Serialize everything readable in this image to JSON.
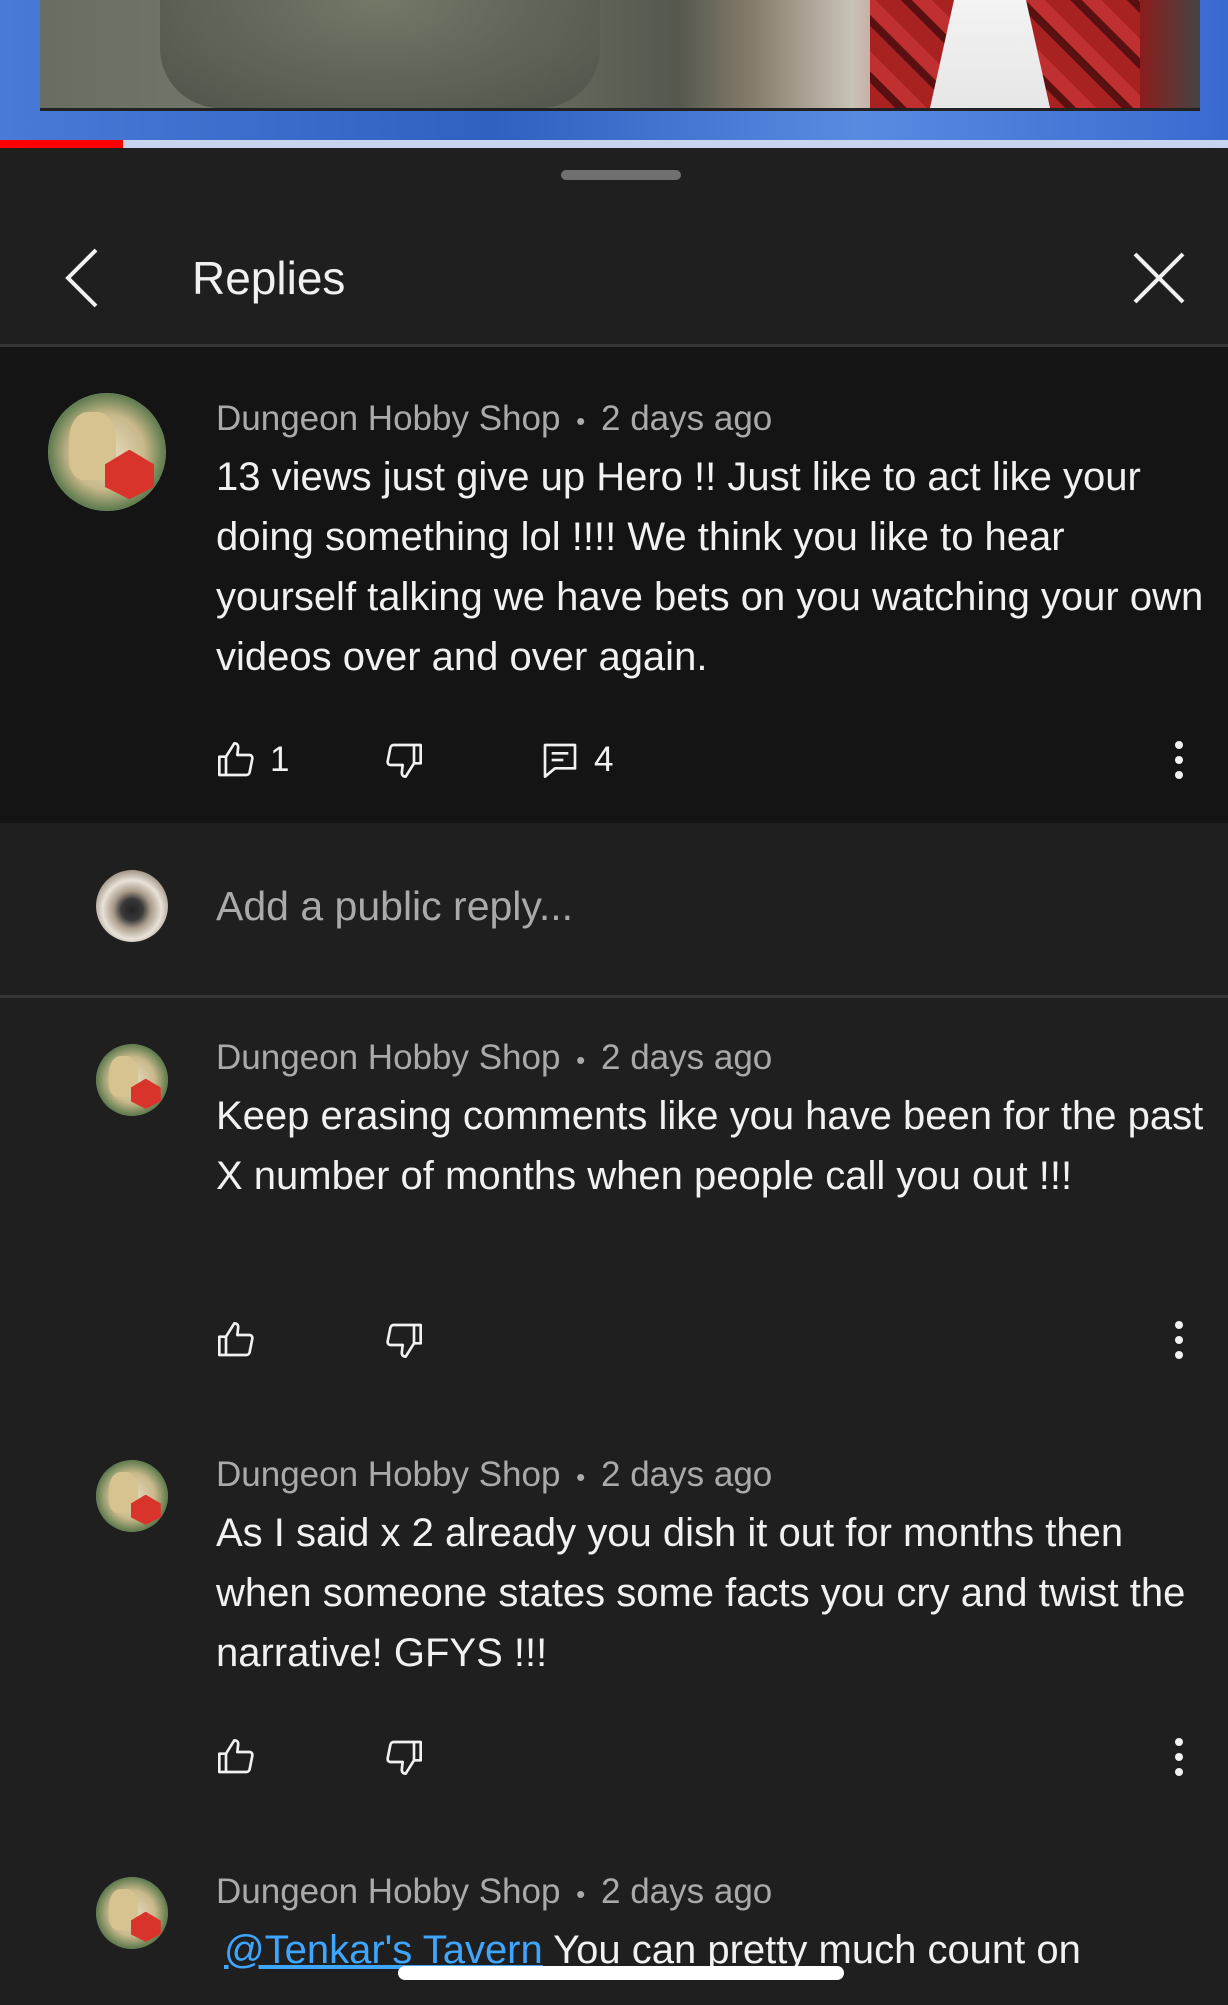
{
  "video": {
    "progress": 0.1
  },
  "header": {
    "title": "Replies",
    "back_icon": "chevron-left-icon",
    "close_icon": "close-icon"
  },
  "parent_comment": {
    "author": "Dungeon Hobby Shop",
    "separator": "•",
    "time": "2 days ago",
    "text": "13 views just give up Hero !!  Just like to act like your doing something lol !!!! We think you like to hear yourself talking we have bets on you watching your own videos over and over again.",
    "likes": "1",
    "replies": "4"
  },
  "reply_input": {
    "placeholder": "Add a public reply..."
  },
  "replies": [
    {
      "author": "Dungeon Hobby Shop",
      "separator": "•",
      "time": "2 days ago",
      "text": "Keep erasing comments like you have been for the past X number of months when people call you out !!!"
    },
    {
      "author": "Dungeon Hobby Shop",
      "separator": "•",
      "time": "2 days ago",
      "text": "As I said x 2 already you dish it out for months then when someone states some facts you cry and twist the narrative! GFYS !!!"
    },
    {
      "author": "Dungeon Hobby Shop",
      "separator": "•",
      "time": "2 days ago",
      "mention": "@Tenkar's Tavern",
      "text": " You can pretty much count on"
    }
  ],
  "colors": {
    "background": "#1f1f1f",
    "parent_background": "#141414",
    "meta_text": "#aaaaaa",
    "mention": "#3ea6ff",
    "progress": "#ff0000"
  }
}
